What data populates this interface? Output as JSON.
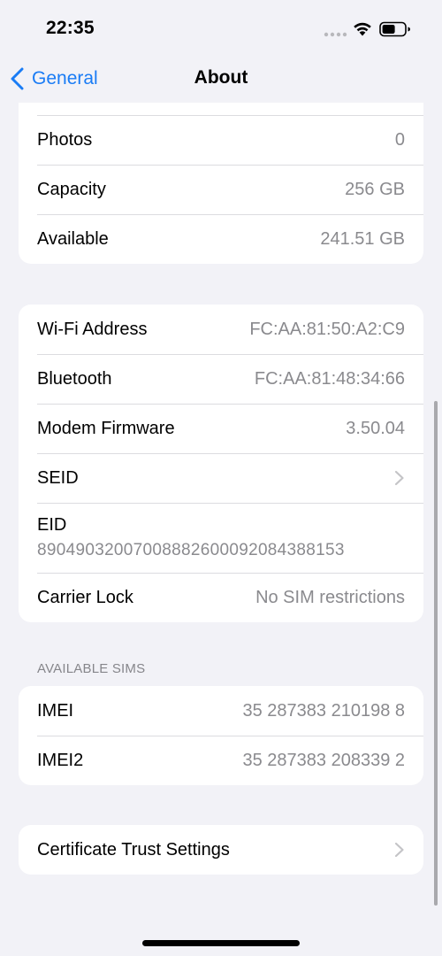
{
  "status_bar": {
    "time": "22:35",
    "icons": [
      "signal-dots-icon",
      "wifi-icon",
      "battery-icon"
    ]
  },
  "nav": {
    "back_label": "General",
    "title": "About"
  },
  "group1": [
    {
      "label": "Photos",
      "value": "0"
    },
    {
      "label": "Capacity",
      "value": "256 GB"
    },
    {
      "label": "Available",
      "value": "241.51 GB"
    }
  ],
  "group2": {
    "wifi": {
      "label": "Wi-Fi Address",
      "value": "FC:AA:81:50:A2:C9"
    },
    "bluetooth": {
      "label": "Bluetooth",
      "value": "FC:AA:81:48:34:66"
    },
    "modem": {
      "label": "Modem Firmware",
      "value": "3.50.04"
    },
    "seid": {
      "label": "SEID"
    },
    "eid": {
      "label": "EID",
      "value": "89049032007008882600092084388153"
    },
    "carrier": {
      "label": "Carrier Lock",
      "value": "No SIM restrictions"
    }
  },
  "sims": {
    "header": "AVAILABLE SIMS",
    "rows": [
      {
        "label": "IMEI",
        "value": "35 287383 210198 8"
      },
      {
        "label": "IMEI2",
        "value": "35 287383 208339 2"
      }
    ]
  },
  "certificate": {
    "label": "Certificate Trust Settings"
  },
  "colors": {
    "accent": "#1a7cf5",
    "background": "#f2f2f7",
    "secondary_text": "#8a8a8e"
  }
}
